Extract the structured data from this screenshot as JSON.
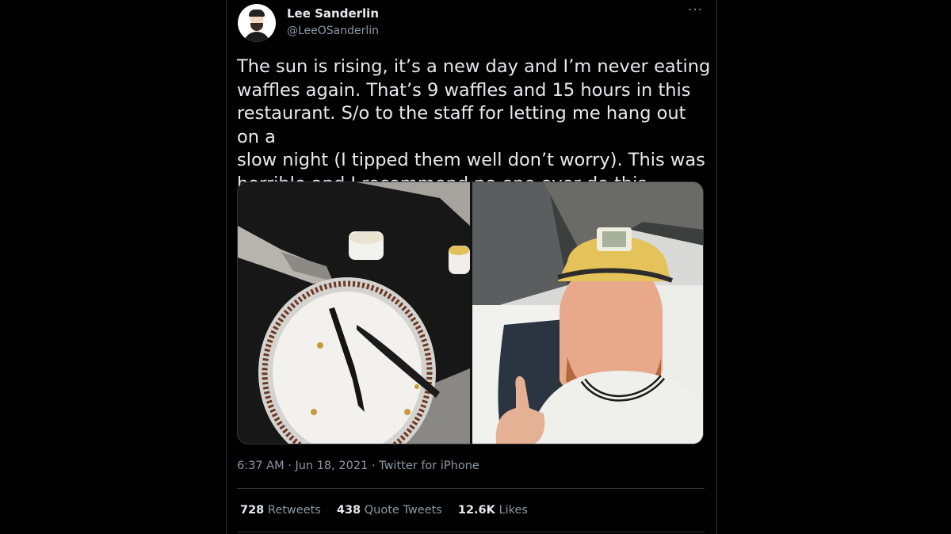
{
  "tweet": {
    "name": "Lee Sanderlin",
    "handle": "@LeeOSanderlin",
    "more_icon": "more-horizontal-icon",
    "text": "The sun is rising, it’s a new day and I’m never eating\nwaffles again. That’s 9 waffles and 15 hours in this\nrestaurant. S/o to the staff for letting me hang out on a\nslow night (I tipped them well don’t worry). This was\nhorrible and I recommend no one ever do this.",
    "time": "6:37 AM",
    "date": "Jun 18, 2021",
    "source": "Twitter for iPhone",
    "separator": "·"
  },
  "stats": {
    "retweets_count": "728",
    "retweets_label": "Retweets",
    "quotes_count": "438",
    "quotes_label": "Quote Tweets",
    "likes_count": "12.6K",
    "likes_label": "Likes"
  }
}
